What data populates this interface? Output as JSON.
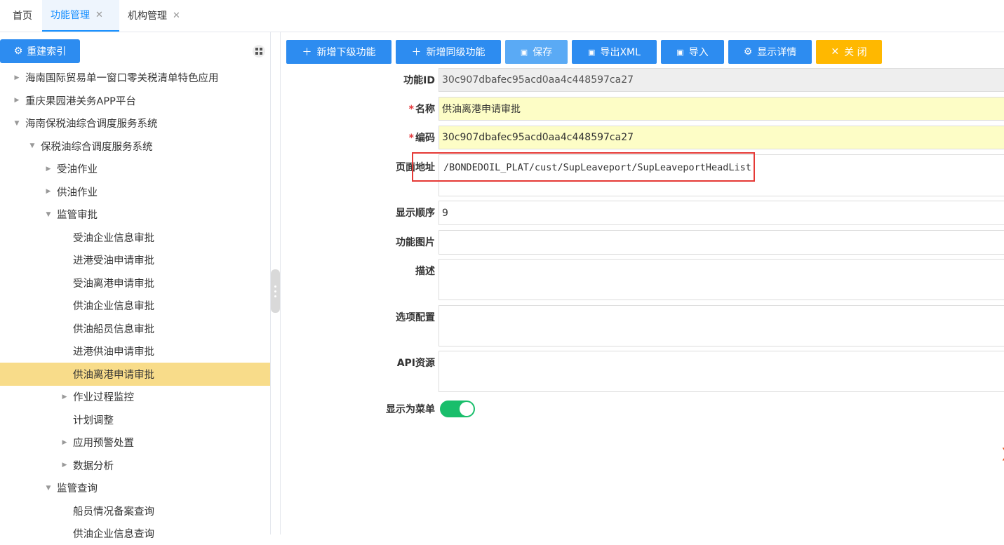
{
  "tabs": [
    {
      "label": "首页",
      "closable": false,
      "active": false
    },
    {
      "label": "功能管理",
      "closable": true,
      "active": true
    },
    {
      "label": "机构管理",
      "closable": true,
      "active": false
    }
  ],
  "left": {
    "rebuild_label": "重建索引",
    "tree": [
      {
        "label": "海南国际贸易单一窗口零关税清单特色应用",
        "level": 0,
        "toggle": "collapsed"
      },
      {
        "label": "重庆果园港关务APP平台",
        "level": 0,
        "toggle": "collapsed"
      },
      {
        "label": "海南保税油综合调度服务系统",
        "level": 0,
        "toggle": "expanded"
      },
      {
        "label": "保税油综合调度服务系统",
        "level": 1,
        "toggle": "expanded"
      },
      {
        "label": "受油作业",
        "level": 2,
        "toggle": "collapsed"
      },
      {
        "label": "供油作业",
        "level": 2,
        "toggle": "collapsed"
      },
      {
        "label": "监管审批",
        "level": 2,
        "toggle": "expanded"
      },
      {
        "label": "受油企业信息审批",
        "level": 3,
        "toggle": "none"
      },
      {
        "label": "进港受油申请审批",
        "level": 3,
        "toggle": "none"
      },
      {
        "label": "受油离港申请审批",
        "level": 3,
        "toggle": "none"
      },
      {
        "label": "供油企业信息审批",
        "level": 3,
        "toggle": "none"
      },
      {
        "label": "供油船员信息审批",
        "level": 3,
        "toggle": "none"
      },
      {
        "label": "进港供油申请审批",
        "level": 3,
        "toggle": "none"
      },
      {
        "label": "供油离港申请审批",
        "level": 3,
        "toggle": "none",
        "selected": true
      },
      {
        "label": "作业过程监控",
        "level": 3,
        "toggle": "collapsed"
      },
      {
        "label": "计划调整",
        "level": 3,
        "toggle": "none"
      },
      {
        "label": "应用预警处置",
        "level": 3,
        "toggle": "collapsed"
      },
      {
        "label": "数据分析",
        "level": 3,
        "toggle": "collapsed"
      },
      {
        "label": "监管查询",
        "level": 2,
        "toggle": "expanded"
      },
      {
        "label": "船员情况备案查询",
        "level": 3,
        "toggle": "none"
      },
      {
        "label": "供油企业信息查询",
        "level": 3,
        "toggle": "none"
      }
    ]
  },
  "toolbar": {
    "add_child": "新增下级功能",
    "add_sibling": "新增同级功能",
    "save": "保存",
    "export_xml": "导出XML",
    "import": "导入",
    "show_detail": "显示详情",
    "close": "关 闭"
  },
  "form": {
    "id_label": "功能ID",
    "id_value": "30c907dbafec95acd0aa4c448597ca27",
    "name_label": "名称",
    "name_value": "供油离港申请审批",
    "code_label": "编码",
    "code_value": "30c907dbafec95acd0aa4c448597ca27",
    "url_label": "页面地址",
    "url_value": "/BONDEDOIL_PLAT/cust/SupLeaveport/SupLeaveportHeadList",
    "order_label": "显示顺序",
    "order_value": "9",
    "image_label": "功能图片",
    "image_value": "",
    "desc_label": "描述",
    "desc_value": "",
    "options_label": "选项配置",
    "options_value": "",
    "api_label": "API资源",
    "api_value": "",
    "menu_label": "显示为菜单",
    "menu_on": true
  },
  "colors": {
    "primary": "#2d8cf0",
    "warning": "#ffb800",
    "selected_row": "#f8dc8a",
    "required_bg": "#fdfdc6",
    "toggle_on": "#19be6b",
    "highlight": "#e53935"
  }
}
